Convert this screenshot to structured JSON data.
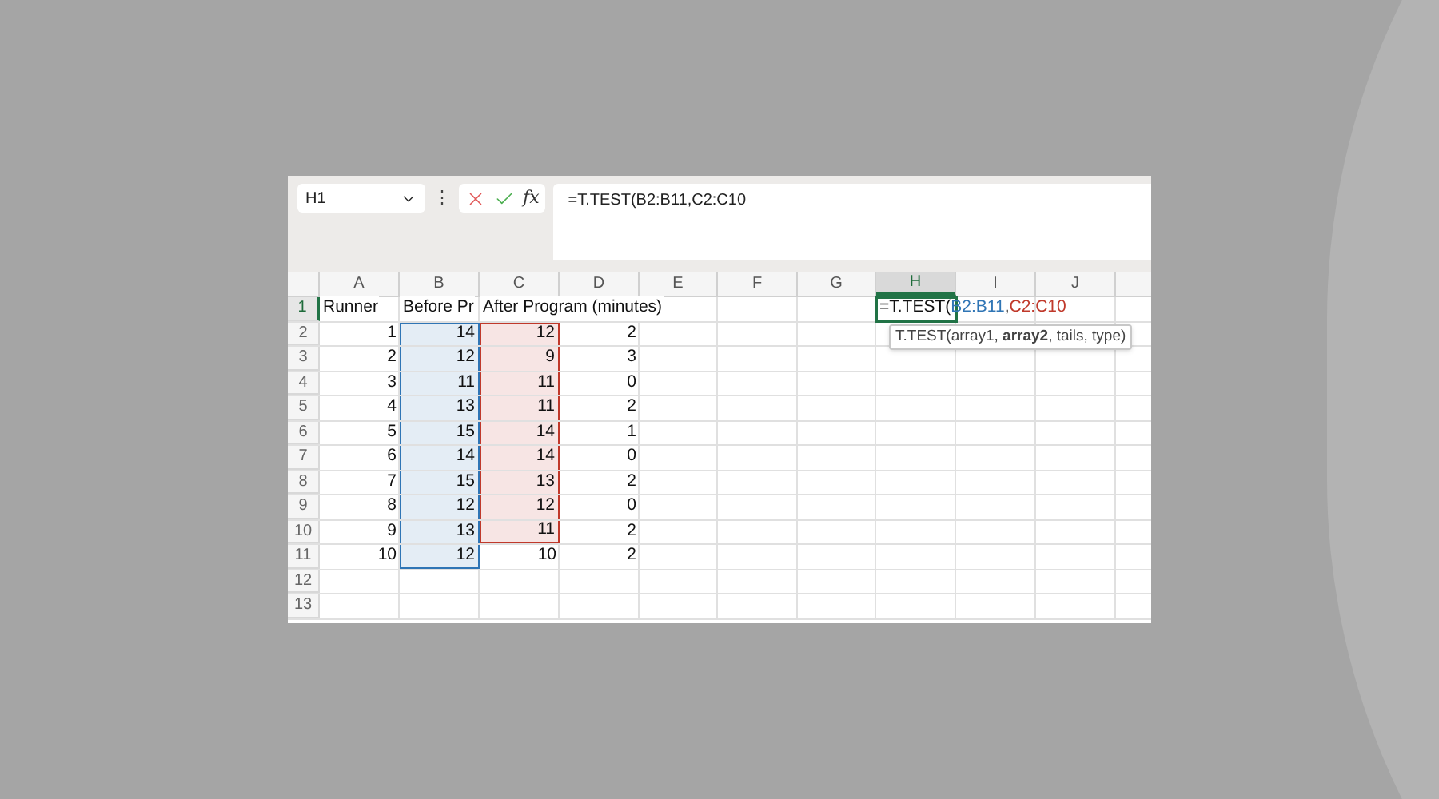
{
  "name_box": {
    "value": "H1"
  },
  "formula_bar": {
    "more": "⋮",
    "function_label": "fx",
    "value": "=T.TEST(B2:B11,C2:C10"
  },
  "columns": [
    {
      "label": "A",
      "selected": false
    },
    {
      "label": "B",
      "selected": false
    },
    {
      "label": "C",
      "selected": false
    },
    {
      "label": "D",
      "selected": false
    },
    {
      "label": "E",
      "selected": false
    },
    {
      "label": "F",
      "selected": false
    },
    {
      "label": "G",
      "selected": false
    },
    {
      "label": "H",
      "selected": true
    },
    {
      "label": "I",
      "selected": false
    },
    {
      "label": "J",
      "selected": false
    }
  ],
  "rows": [
    {
      "header": "1",
      "selected": true,
      "cells": [
        {
          "kind": "text",
          "text": "Runner"
        },
        {
          "kind": "text",
          "text": "Before Pr"
        },
        {
          "kind": "text",
          "text": "After Program (minutes)"
        },
        {},
        {},
        {},
        {},
        {
          "kind": "formula",
          "active": true,
          "segments": [
            {
              "text": "=T.TEST("
            },
            {
              "text": "B2:B11",
              "color": "#2f75b5"
            },
            {
              "text": ","
            },
            {
              "text": "C2:C10",
              "color": "#c0392b"
            }
          ],
          "tooltip": "T.TEST(array1, **array2**, tails, type)"
        }
      ]
    },
    {
      "header": "2",
      "selected": false,
      "cells": [
        {
          "kind": "number",
          "text": "1"
        },
        {
          "kind": "number",
          "text": "14",
          "color": "#2f75b5"
        },
        {
          "kind": "number",
          "text": "12",
          "color": "#c0392b"
        },
        {
          "kind": "number",
          "text": "2"
        }
      ]
    },
    {
      "header": "3",
      "selected": false,
      "cells": [
        {
          "kind": "number",
          "text": "2"
        },
        {
          "kind": "number",
          "text": "12",
          "color": "#2f75b5"
        },
        {
          "kind": "number",
          "text": "9",
          "color": "#c0392b"
        },
        {
          "kind": "number",
          "text": "3"
        }
      ]
    },
    {
      "header": "4",
      "selected": false,
      "cells": [
        {
          "kind": "number",
          "text": "3"
        },
        {
          "kind": "number",
          "text": "11",
          "color": "#2f75b5"
        },
        {
          "kind": "number",
          "text": "11",
          "color": "#c0392b"
        },
        {
          "kind": "number",
          "text": "0"
        }
      ]
    },
    {
      "header": "5",
      "selected": false,
      "cells": [
        {
          "kind": "number",
          "text": "4"
        },
        {
          "kind": "number",
          "text": "13",
          "color": "#2f75b5"
        },
        {
          "kind": "number",
          "text": "11",
          "color": "#c0392b"
        },
        {
          "kind": "number",
          "text": "2"
        }
      ]
    },
    {
      "header": "6",
      "selected": false,
      "cells": [
        {
          "kind": "number",
          "text": "5"
        },
        {
          "kind": "number",
          "text": "15",
          "color": "#2f75b5"
        },
        {
          "kind": "number",
          "text": "14",
          "color": "#c0392b"
        },
        {
          "kind": "number",
          "text": "1"
        }
      ]
    },
    {
      "header": "7",
      "selected": false,
      "cells": [
        {
          "kind": "number",
          "text": "6"
        },
        {
          "kind": "number",
          "text": "14",
          "color": "#2f75b5"
        },
        {
          "kind": "number",
          "text": "14",
          "color": "#c0392b"
        },
        {
          "kind": "number",
          "text": "0"
        }
      ]
    },
    {
      "header": "8",
      "selected": false,
      "cells": [
        {
          "kind": "number",
          "text": "7"
        },
        {
          "kind": "number",
          "text": "15",
          "color": "#2f75b5"
        },
        {
          "kind": "number",
          "text": "13",
          "color": "#c0392b"
        },
        {
          "kind": "number",
          "text": "2"
        }
      ]
    },
    {
      "header": "9",
      "selected": false,
      "cells": [
        {
          "kind": "number",
          "text": "8"
        },
        {
          "kind": "number",
          "text": "12",
          "color": "#2f75b5"
        },
        {
          "kind": "number",
          "text": "12",
          "color": "#c0392b"
        },
        {
          "kind": "number",
          "text": "0"
        }
      ]
    },
    {
      "header": "10",
      "selected": false,
      "cells": [
        {
          "kind": "number",
          "text": "9"
        },
        {
          "kind": "number",
          "text": "13",
          "color": "#2f75b5"
        },
        {
          "kind": "number",
          "text": "11",
          "color": "#c0392b"
        },
        {
          "kind": "number",
          "text": "2"
        }
      ]
    },
    {
      "header": "11",
      "selected": false,
      "cells": [
        {
          "kind": "number",
          "text": "10"
        },
        {
          "kind": "number",
          "text": "12",
          "color": "#2f75b5"
        },
        {
          "kind": "number",
          "text": "10"
        },
        {
          "kind": "number",
          "text": "2"
        }
      ]
    },
    {
      "header": "12",
      "selected": false
    },
    {
      "header": "13",
      "selected": false
    }
  ]
}
